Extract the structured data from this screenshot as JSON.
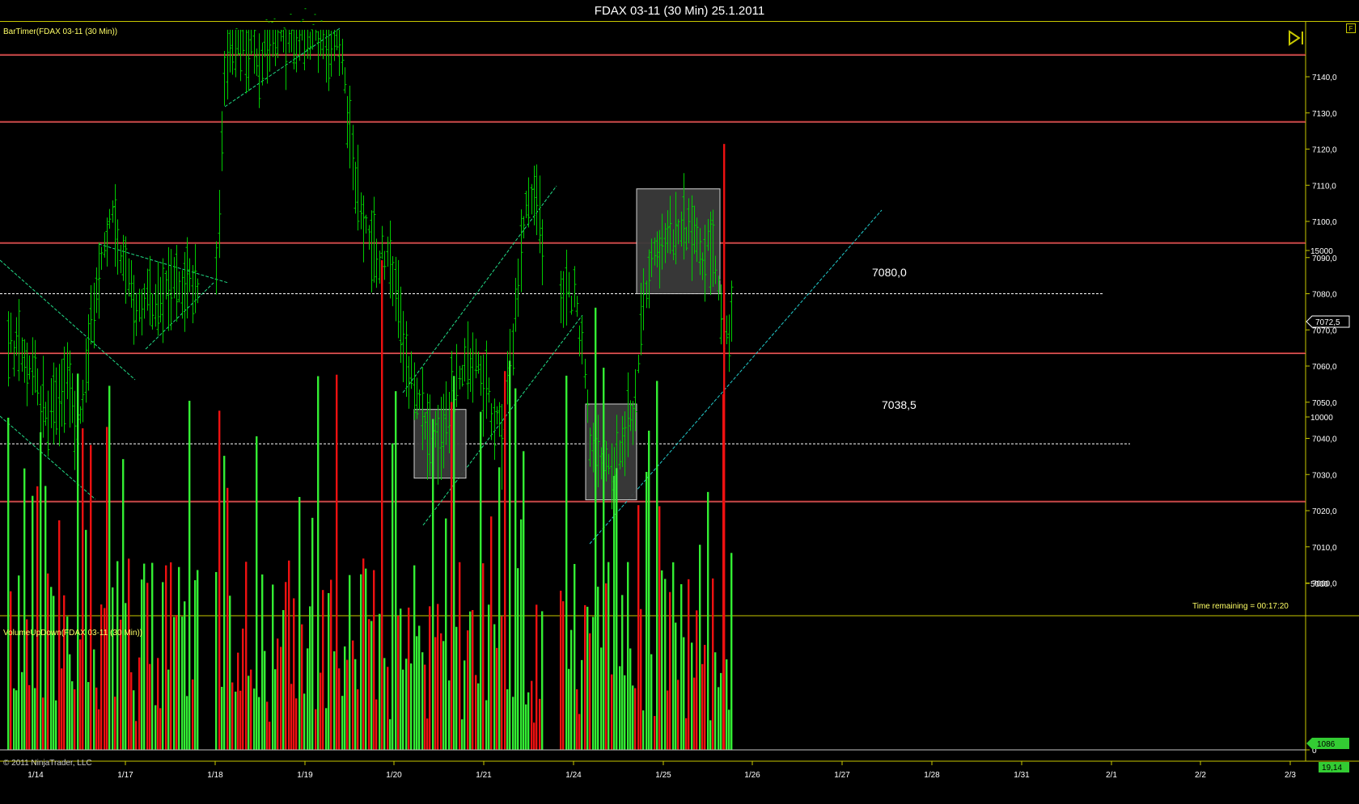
{
  "window_title": "FDAX 03-11 (30 Min)  25.1.2011",
  "price_panel": {
    "indicator_label": "BarTimer(FDAX 03-11 (30 Min))",
    "time_remaining": "Time remaining = 00:17:20",
    "current_price_tag": "7072,5",
    "f_button": "F"
  },
  "volume_panel": {
    "indicator_label": "VolumeUpDown(FDAX 03-11 (30 Min))",
    "current_volume_tag": "1086",
    "zero_label": "0"
  },
  "bottom_tag": "19,14",
  "copyright": "© 2011 NinjaTrader, LLC",
  "colors": {
    "up_bar": "#00cc00",
    "up_volume": "#33ee33",
    "down_volume": "#ee1111",
    "resistance_line": "#ff4040",
    "channel_line": "#22dd88",
    "support_trend": "#22cccc",
    "zone_fill": "#3a3a3a",
    "axis": "#c8c800"
  },
  "chart_data": [
    {
      "type": "ohlc",
      "title": "FDAX 03-11 (30 Min)  25.1.2011",
      "x_ticks": [
        "1/14",
        "1/17",
        "1/18",
        "1/19",
        "1/20",
        "1/21",
        "1/24",
        "1/25",
        "1/26",
        "1/27",
        "1/28",
        "1/31",
        "2/1",
        "2/2",
        "2/3"
      ],
      "y_ticks": [
        "7000,0",
        "7010,0",
        "7020,0",
        "7030,0",
        "7040,0",
        "7050,0",
        "7060,0",
        "7070,0",
        "7080,0",
        "7090,0",
        "7100,0",
        "7110,0",
        "7120,0",
        "7130,0",
        "7140,0"
      ],
      "ylim": [
        6990,
        7154
      ],
      "horizontal_levels": [
        7146,
        7127.5,
        7094,
        7063.5,
        7022.5
      ],
      "dashed_levels": [
        {
          "value": 7080.0,
          "label": "7080,0"
        },
        {
          "value": 7038.5,
          "label": "7038,5"
        }
      ],
      "last_price": 7072.5,
      "annotation_zones": [
        {
          "start": "1/20",
          "end": "1/20 late",
          "high": 7048,
          "low": 7029
        },
        {
          "start": "1/24",
          "end": "1/24 late",
          "high": 7049.5,
          "low": 7023
        },
        {
          "start": "1/24 late",
          "end": "1/25 late",
          "high": 7109,
          "low": 7080
        }
      ],
      "session_closes_approx": [
        {
          "date": "1/14",
          "close": 7045
        },
        {
          "date": "1/17",
          "close": 7082
        },
        {
          "date": "1/18",
          "close": 7150
        },
        {
          "date": "1/19",
          "close": 7092
        },
        {
          "date": "1/20",
          "close": 7040
        },
        {
          "date": "1/21",
          "close": 7085
        },
        {
          "date": "1/24",
          "close": 7045
        },
        {
          "date": "1/25",
          "close": 7072.5
        }
      ]
    },
    {
      "type": "bar",
      "title": "VolumeUpDown(FDAX 03-11 (30 Min))",
      "y_ticks": [
        "0",
        "5000",
        "10000",
        "15000"
      ],
      "ylim": [
        0,
        18000
      ],
      "last_value": 1086,
      "series": [
        {
          "name": "up",
          "color": "#33ee33"
        },
        {
          "name": "down",
          "color": "#ee1111"
        }
      ]
    }
  ]
}
